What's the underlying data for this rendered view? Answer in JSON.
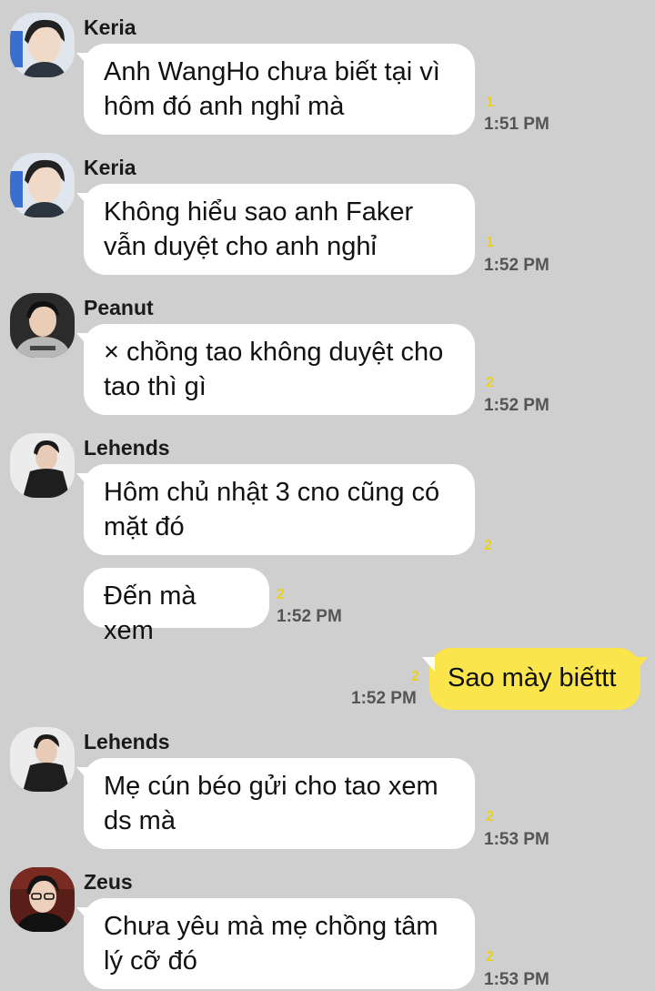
{
  "colors": {
    "background": "#cfcfcf",
    "incoming_bubble": "#ffffff",
    "outgoing_bubble": "#fbe54d",
    "unread": "#e8d21b"
  },
  "messages": [
    {
      "sender": "Keria",
      "text": "Anh WangHo chưa biết tại vì\nhôm đó anh nghỉ mà",
      "unread": "1",
      "time": "1:51 PM"
    },
    {
      "sender": "Keria",
      "text": "Không hiểu sao anh Faker\nvẫn duyệt cho anh nghỉ",
      "unread": "1",
      "time": "1:52 PM"
    },
    {
      "sender": "Peanut",
      "text": "× chồng tao không duyệt cho\ntao thì gì",
      "unread": "2",
      "time": "1:52 PM"
    },
    {
      "sender": "Lehends",
      "text": "Hôm chủ nhật 3 cno cũng có\nmặt đó",
      "unread": "2"
    },
    {
      "text": "Đến mà xem",
      "unread": "2",
      "time": "1:52 PM"
    },
    {
      "text": "Sao mày biếttt",
      "unread": "2",
      "time": "1:52 PM",
      "outgoing": true
    },
    {
      "sender": "Lehends",
      "text": "Mẹ cún béo gửi cho tao xem\nds mà",
      "unread": "2",
      "time": "1:53 PM"
    },
    {
      "sender": "Zeus",
      "text": "Chưa yêu mà mẹ chồng tâm\nlý cỡ đó",
      "unread": "2",
      "time": "1:53 PM"
    }
  ]
}
